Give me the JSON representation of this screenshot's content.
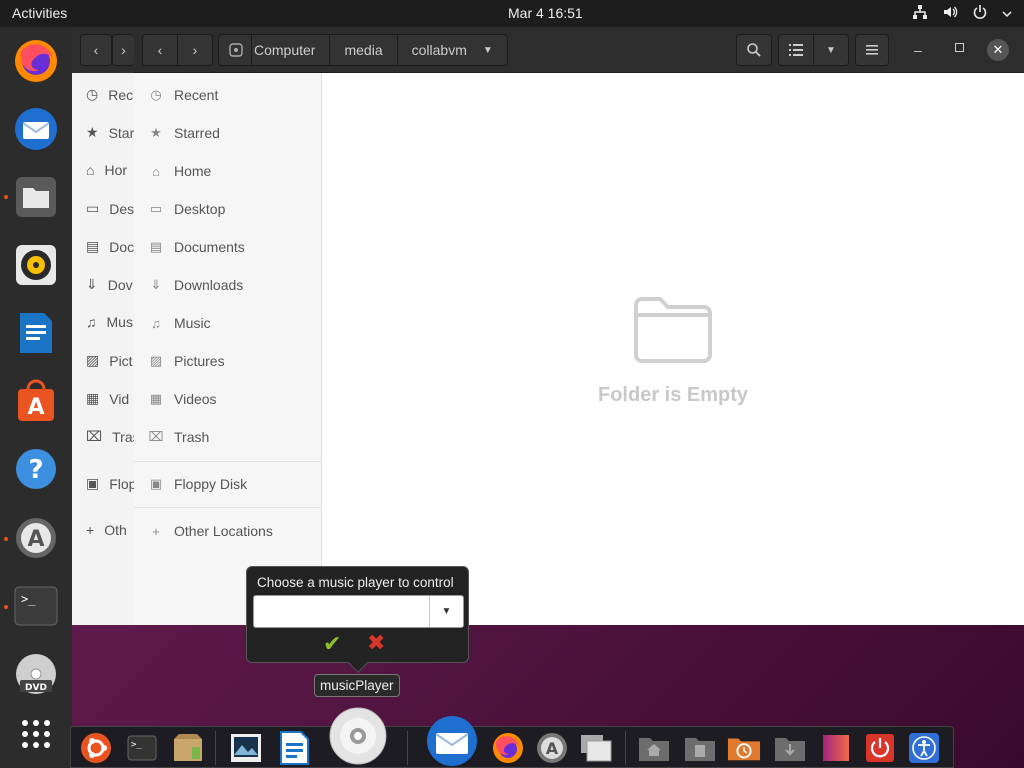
{
  "topbar": {
    "activities": "Activities",
    "clock": "Mar 4  16:51"
  },
  "window": {
    "path": [
      "Computer",
      "media",
      "collabvm"
    ],
    "sidebar": [
      {
        "label": "Recent",
        "icon": "clock-icon"
      },
      {
        "label": "Starred",
        "icon": "star-icon"
      },
      {
        "label": "Home",
        "icon": "home-icon"
      },
      {
        "label": "Desktop",
        "icon": "desktop-icon"
      },
      {
        "label": "Documents",
        "icon": "document-icon"
      },
      {
        "label": "Downloads",
        "icon": "download-icon"
      },
      {
        "label": "Music",
        "icon": "music-icon"
      },
      {
        "label": "Pictures",
        "icon": "picture-icon"
      },
      {
        "label": "Videos",
        "icon": "video-icon"
      },
      {
        "label": "Trash",
        "icon": "trash-icon"
      },
      {
        "label": "Floppy Disk",
        "icon": "floppy-icon"
      },
      {
        "label": "Other Locations",
        "icon": "plus-icon"
      }
    ],
    "back_sidebar": [
      "Rec",
      "Star",
      "Hor",
      "Des",
      "Doc",
      "Dov",
      "Mus",
      "Pict",
      "Vid",
      "Tras",
      "Flop",
      "Oth"
    ],
    "empty_label": "Folder is Empty"
  },
  "popup": {
    "title": "Choose a music player to control",
    "combo_value": ""
  },
  "tooltip": "musicPlayer"
}
